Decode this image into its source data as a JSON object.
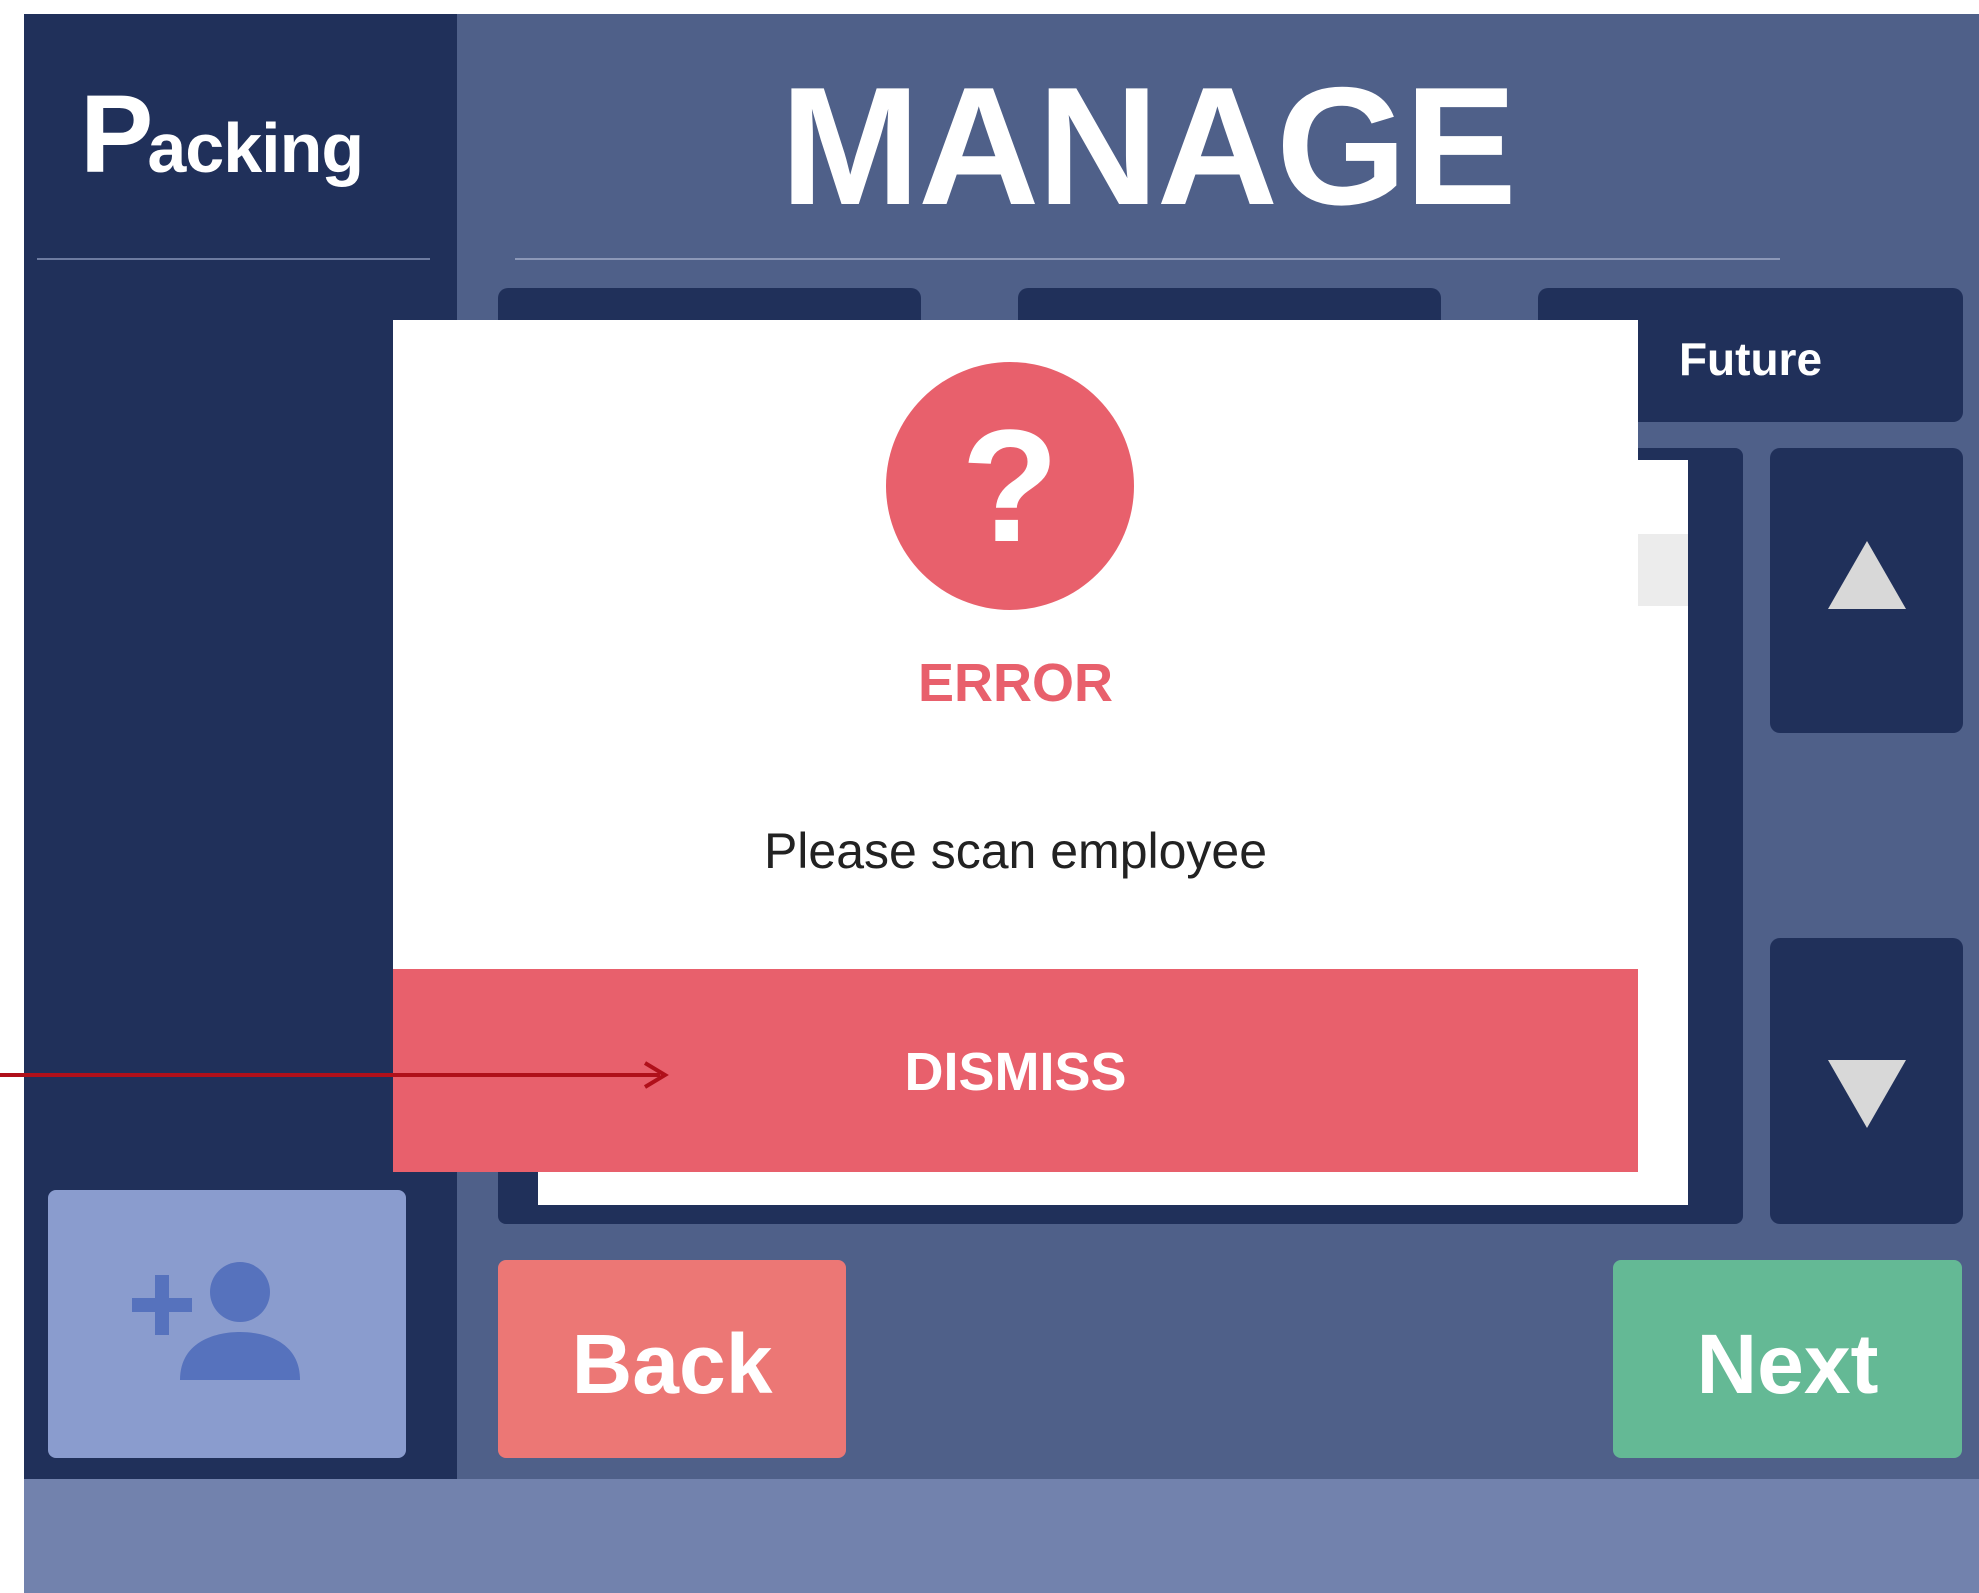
{
  "app": {
    "logo_big": "P",
    "logo_small": "acking"
  },
  "header": {
    "title": "MANAGE"
  },
  "tabs": [
    {
      "label": ""
    },
    {
      "label": ""
    },
    {
      "label": "Future"
    }
  ],
  "scroll": {
    "up_icon": "triangle-up-icon",
    "down_icon": "triangle-down-icon"
  },
  "sidebar": {
    "add_user_icon": "add-user-icon"
  },
  "footer": {
    "back_label": "Back",
    "next_label": "Next"
  },
  "modal": {
    "icon_glyph": "?",
    "title": "ERROR",
    "message": "Please scan employee",
    "dismiss_label": "DISMISS"
  },
  "colors": {
    "frame": "#4f6089",
    "sidebar": "#20305a",
    "error": "#e8606c",
    "back": "#ec7775",
    "next": "#64b995",
    "add_user": "#8a9cce",
    "footer_bar": "#7282ad",
    "annotation_arrow": "#b0101a"
  }
}
